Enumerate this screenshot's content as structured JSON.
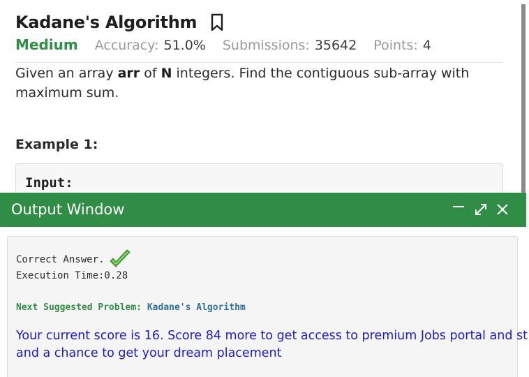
{
  "problem": {
    "title": "Kadane's Algorithm",
    "difficulty": "Medium",
    "accuracy_label": "Accuracy:",
    "accuracy_value": "51.0%",
    "submissions_label": "Submissions:",
    "submissions_value": "35642",
    "points_label": "Points:",
    "points_value": "4",
    "statement": {
      "part1": "Given an array ",
      "bold1": "arr",
      "part2": " of ",
      "bold2": "N",
      "part3": " integers. Find the contiguous sub-array with maximum sum."
    },
    "example_title": "Example 1:",
    "example_input_label": "Input:"
  },
  "output_window": {
    "title": "Output Window",
    "correct_answer": "Correct Answer.",
    "execution_time": "Execution Time:0.28",
    "next_label": "Next Suggested Problem:",
    "next_problem": "Kadane's Algorithm",
    "score_line1": "Your current score is 16. Score 84 more to get access to premium Jobs portal and st",
    "score_line2": "and a chance to get your dream placement"
  },
  "icons": {
    "bookmark": "bookmark-icon",
    "minimize": "minimize-icon",
    "maximize": "expand-icon",
    "close": "close-icon",
    "check": "checkmark-icon"
  },
  "colors": {
    "brand_green": "#2f8d46",
    "link_blue": "#2f6fa3",
    "score_blue": "#1a1ad6"
  }
}
